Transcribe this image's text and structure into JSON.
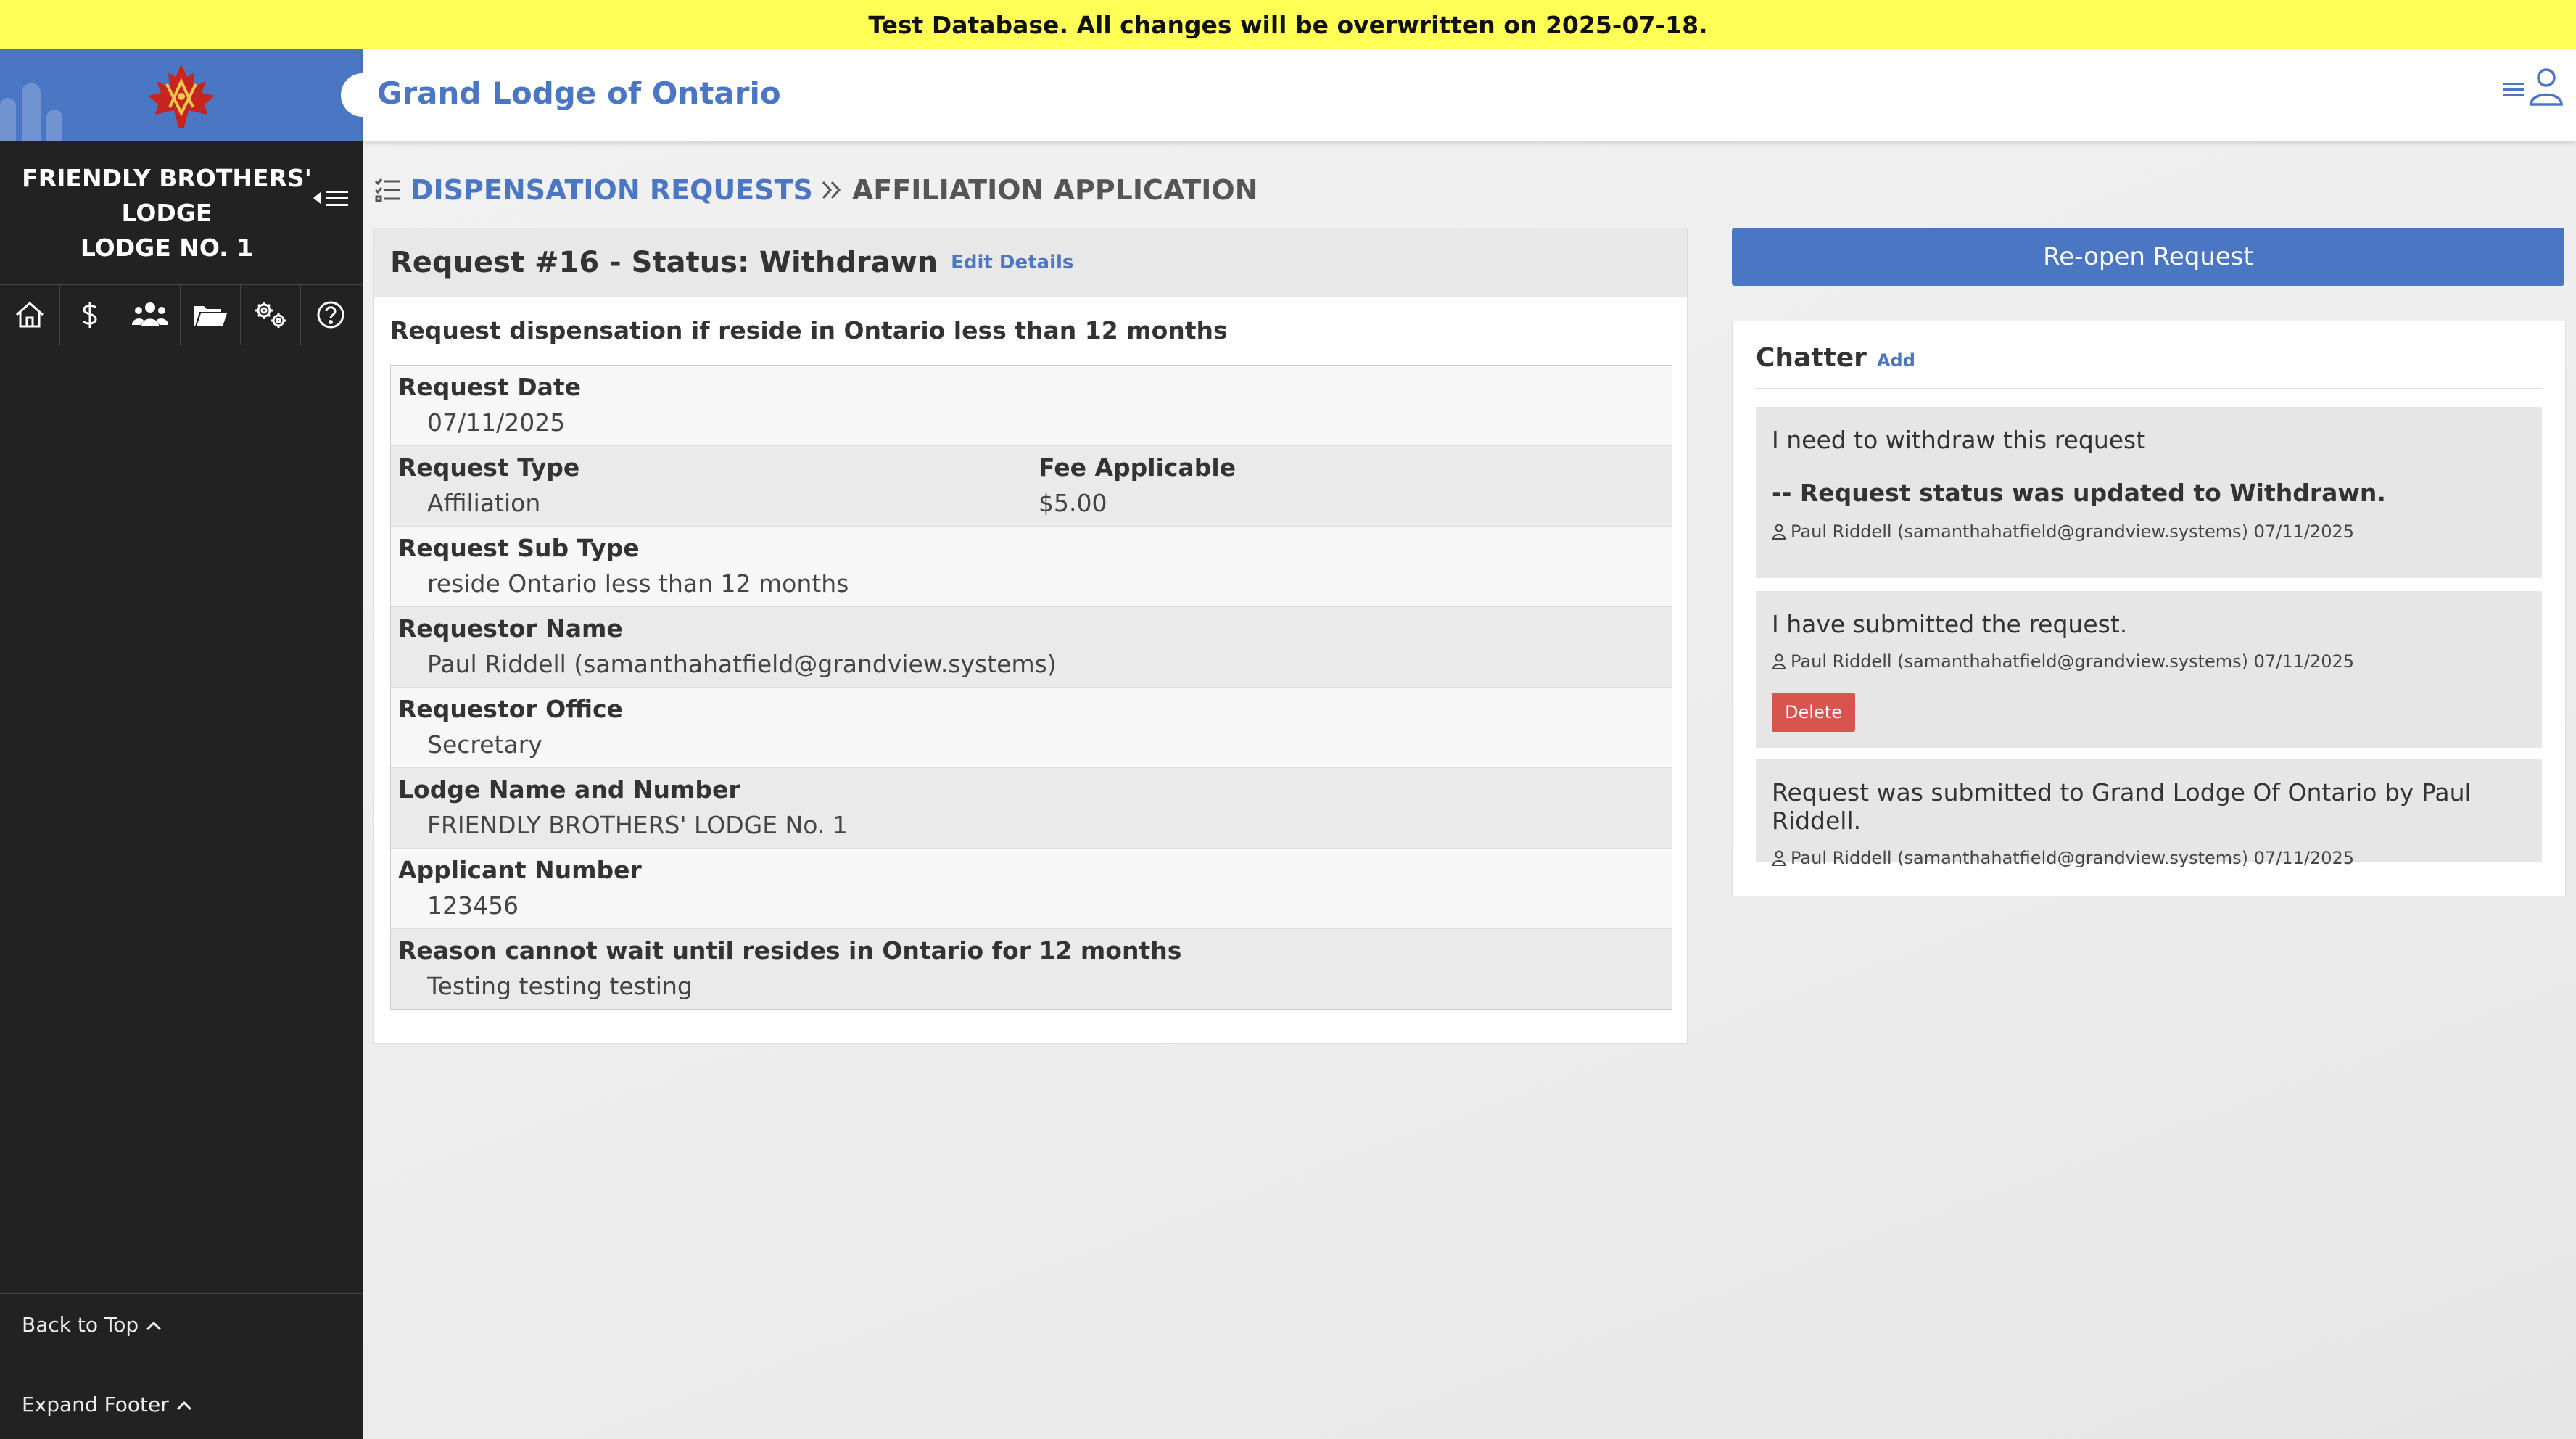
{
  "banner": {
    "text": "Test Database. All changes will be overwritten on 2025-07-18."
  },
  "sidebar": {
    "lodge_line1": "FRIENDLY BROTHERS'",
    "lodge_line2": "LODGE",
    "lodge_line3": "LODGE NO. 1",
    "nav_icons": [
      "home-icon",
      "dollar-icon",
      "members-icon",
      "folder-icon",
      "settings-icon",
      "help-icon"
    ],
    "back_to_top": "Back to Top",
    "expand_footer": "Expand Footer"
  },
  "header": {
    "title": "Grand Lodge of Ontario"
  },
  "breadcrumb": {
    "parent": "DISPENSATION REQUESTS",
    "current": "AFFILIATION APPLICATION"
  },
  "request": {
    "title": "Request #16 - Status: Withdrawn",
    "edit_label": "Edit Details",
    "subheading": "Request dispensation if reside in Ontario less than 12 months",
    "fields": [
      {
        "label": "Request Date",
        "value": "07/11/2025"
      },
      {
        "label": "Request Type",
        "value": "Affiliation",
        "label2": "Fee Applicable",
        "value2": "$5.00"
      },
      {
        "label": "Request Sub Type",
        "value": "reside Ontario less than 12 months"
      },
      {
        "label": "Requestor Name",
        "value": "Paul Riddell (samanthahatfield@grandview.systems)"
      },
      {
        "label": "Requestor Office",
        "value": "Secretary"
      },
      {
        "label": "Lodge Name and Number",
        "value": "FRIENDLY BROTHERS' LODGE No. 1"
      },
      {
        "label": "Applicant Number",
        "value": "123456"
      },
      {
        "label": "Reason cannot wait until resides in Ontario for 12 months",
        "value": "Testing testing testing"
      }
    ]
  },
  "actions": {
    "reopen_label": "Re-open Request"
  },
  "chatter": {
    "title": "Chatter",
    "add_label": "Add",
    "messages": [
      {
        "text": "I need to withdraw this request",
        "status": "-- Request status was updated to Withdrawn.",
        "meta": "Paul Riddell (samanthahatfield@grandview.systems) 07/11/2025"
      },
      {
        "text": "I have submitted the request.",
        "meta": "Paul Riddell (samanthahatfield@grandview.systems) 07/11/2025",
        "delete_label": "Delete"
      },
      {
        "text": "Request was submitted to Grand Lodge Of Ontario by Paul Riddell.",
        "meta": "Paul Riddell (samanthahatfield@grandview.systems) 07/11/2025"
      }
    ]
  },
  "colors": {
    "accent": "#4a76c4",
    "sidebar": "#222222",
    "banner": "#ffff55",
    "danger": "#d9534f"
  }
}
